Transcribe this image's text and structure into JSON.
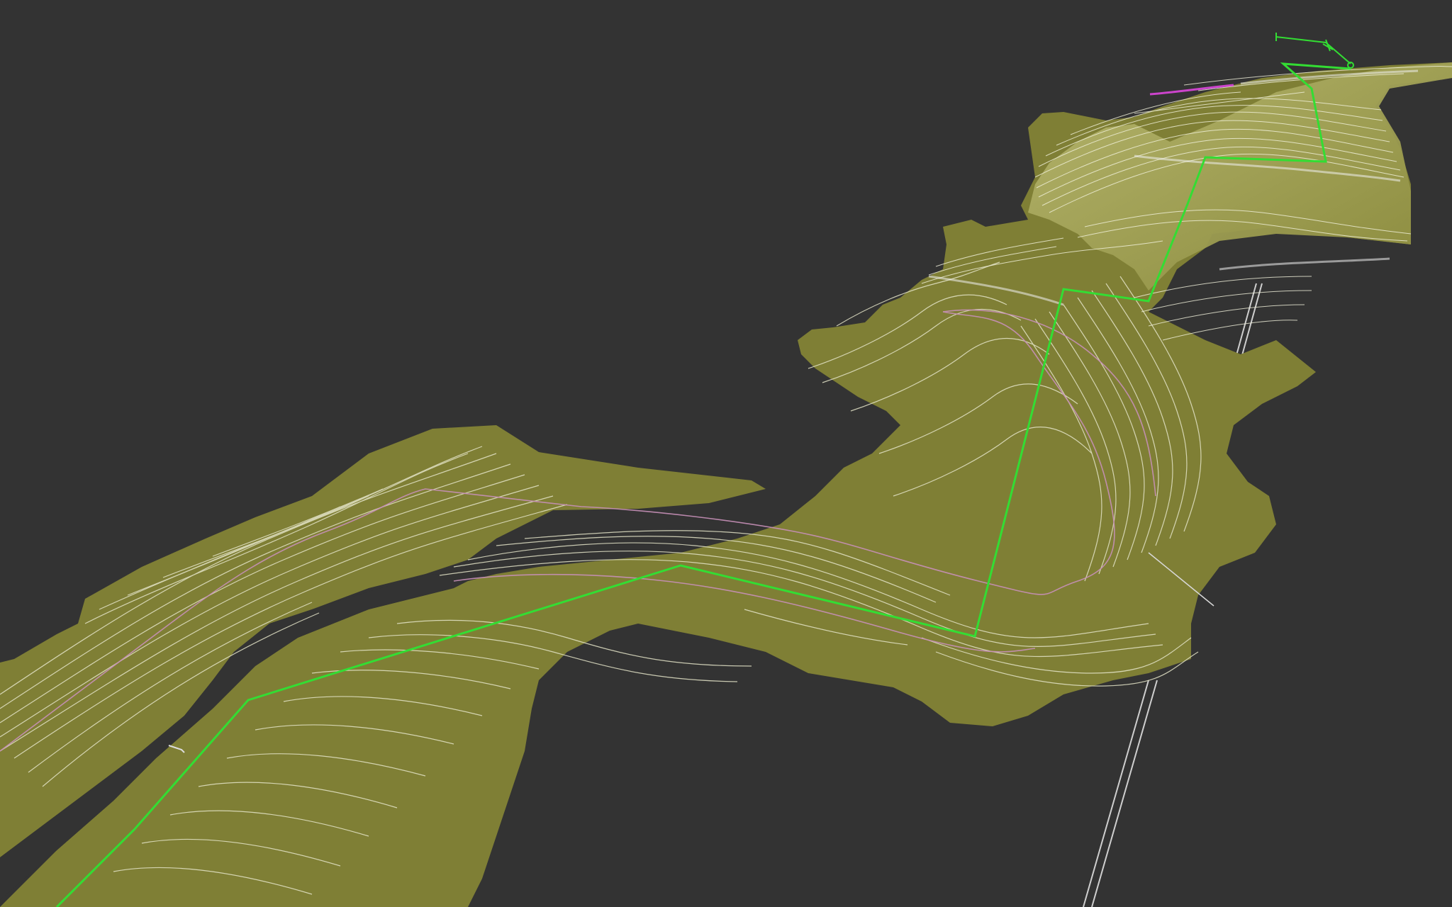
{
  "viewport": {
    "background": "#333333"
  },
  "terrain": {
    "fill": "#7f7f35",
    "fill_light": "#a8a854",
    "contour_color": "#e4e4c8",
    "boundary_color": "#c08ab0"
  },
  "alignment": {
    "color": "#33dd33"
  },
  "secondary_alignment": {
    "color": "#cc44cc"
  },
  "support_lines": {
    "color": "#d0d0d0"
  }
}
